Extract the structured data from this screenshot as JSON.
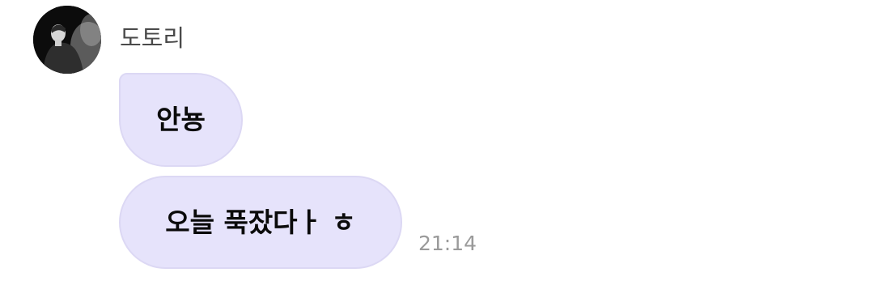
{
  "sender": {
    "name": "도토리",
    "avatar": "profile-photo"
  },
  "messages": [
    {
      "text": "안뇽"
    },
    {
      "text": "오늘 푹잤다ㅏ ㅎ",
      "time": "21:14"
    }
  ],
  "colors": {
    "bubble": "#e6e3fb",
    "bubble_border": "#dcd8f4",
    "name": "#4a4a4a",
    "timestamp": "#9a9a9a"
  }
}
